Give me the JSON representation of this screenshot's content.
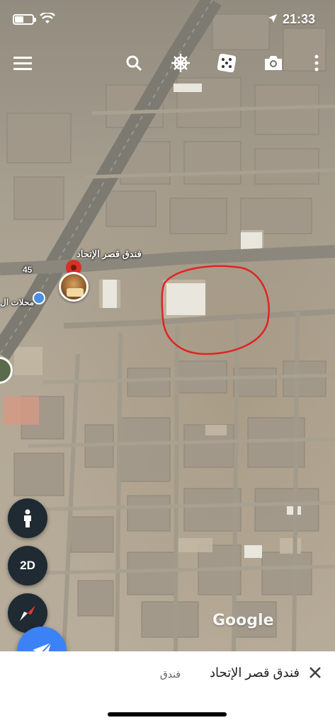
{
  "status_bar": {
    "time": "21:33"
  },
  "toolbar": {
    "icons": [
      "menu-icon",
      "search-icon",
      "voyager-wheel-icon",
      "dice-icon",
      "camera-icon",
      "more-icon"
    ]
  },
  "map": {
    "hotel_label": "فندق قصر الإتحاد",
    "shops_label": "محلات ال",
    "road_number": "45",
    "attribution": "Google",
    "annotation_color": "#e02424"
  },
  "controls": {
    "mode_2d_label": "2D"
  },
  "place_panel": {
    "title": "فندق قصر الإتحاد",
    "category": "فندق"
  },
  "colors": {
    "fab_dark": "#1f2a33",
    "fab_accent": "#3b82f6",
    "pin_red": "#d93025"
  }
}
